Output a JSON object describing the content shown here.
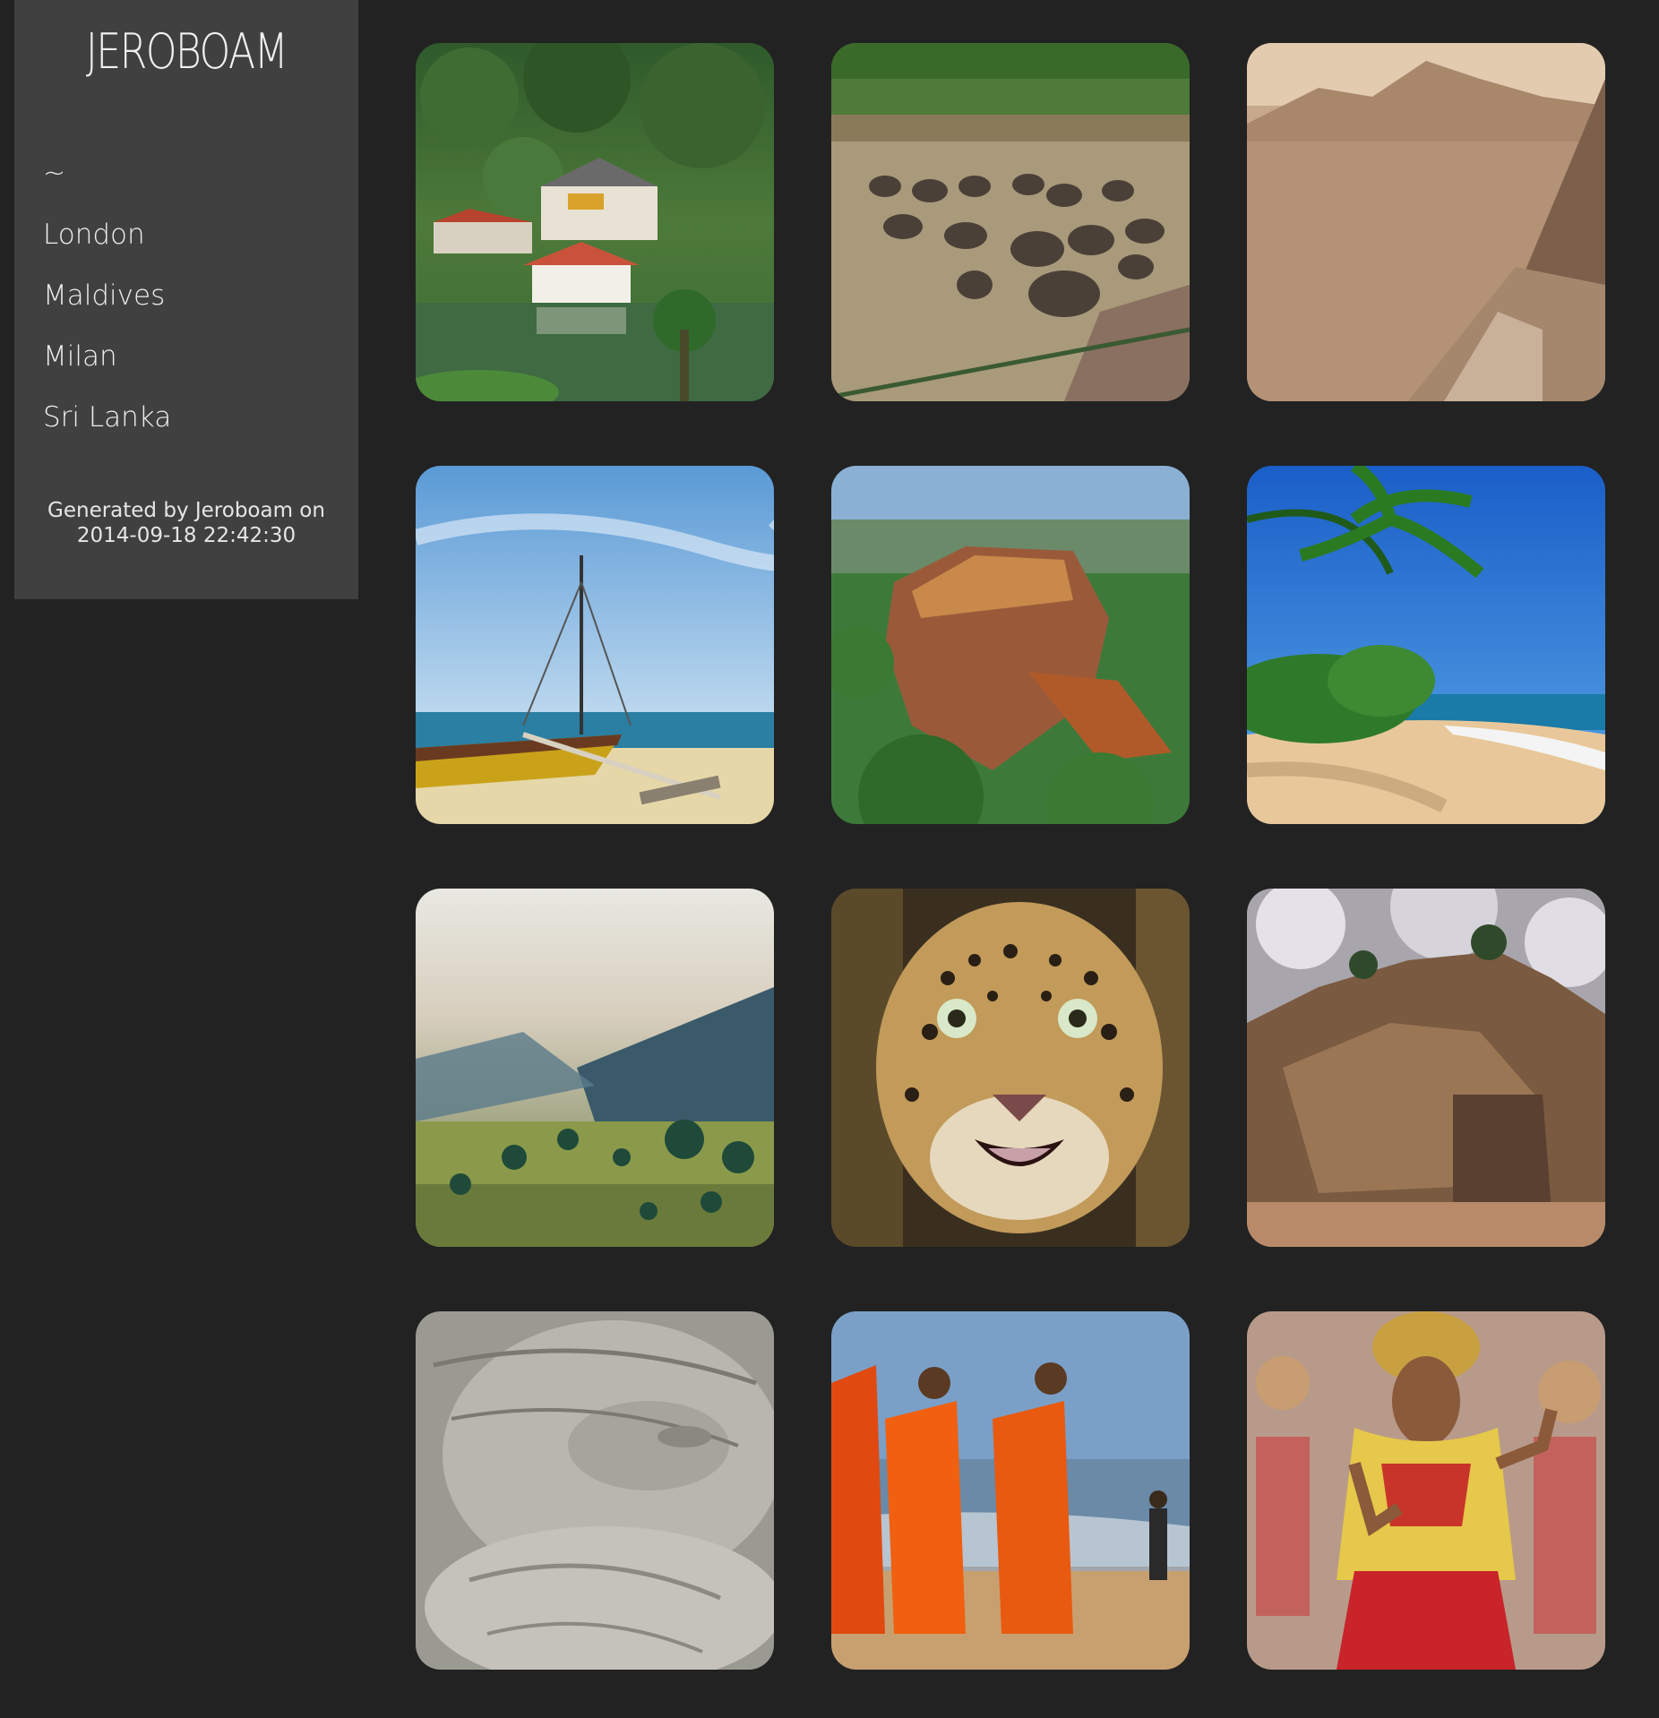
{
  "sidebar": {
    "title": "JEROBOAM",
    "nav": [
      {
        "label": "~"
      },
      {
        "label": "London"
      },
      {
        "label": "Maldives"
      },
      {
        "label": "Milan"
      },
      {
        "label": "Sri Lanka"
      }
    ],
    "footer_line1": "Generated by Jeroboam on",
    "footer_line2": "2014-09-18 22:42:30"
  },
  "gallery": {
    "photos": [
      {
        "subject": "temple-by-lake"
      },
      {
        "subject": "elephants-in-river"
      },
      {
        "subject": "sepia-ruins"
      },
      {
        "subject": "outrigger-boat-beach"
      },
      {
        "subject": "sigiriya-rock-aerial"
      },
      {
        "subject": "palm-beach"
      },
      {
        "subject": "misty-valley"
      },
      {
        "subject": "leopard"
      },
      {
        "subject": "rock-fortress"
      },
      {
        "subject": "reclining-buddha"
      },
      {
        "subject": "monks-on-beach"
      },
      {
        "subject": "dancer"
      }
    ]
  },
  "colors": {
    "background": "#222222",
    "sidebar": "#404040"
  }
}
